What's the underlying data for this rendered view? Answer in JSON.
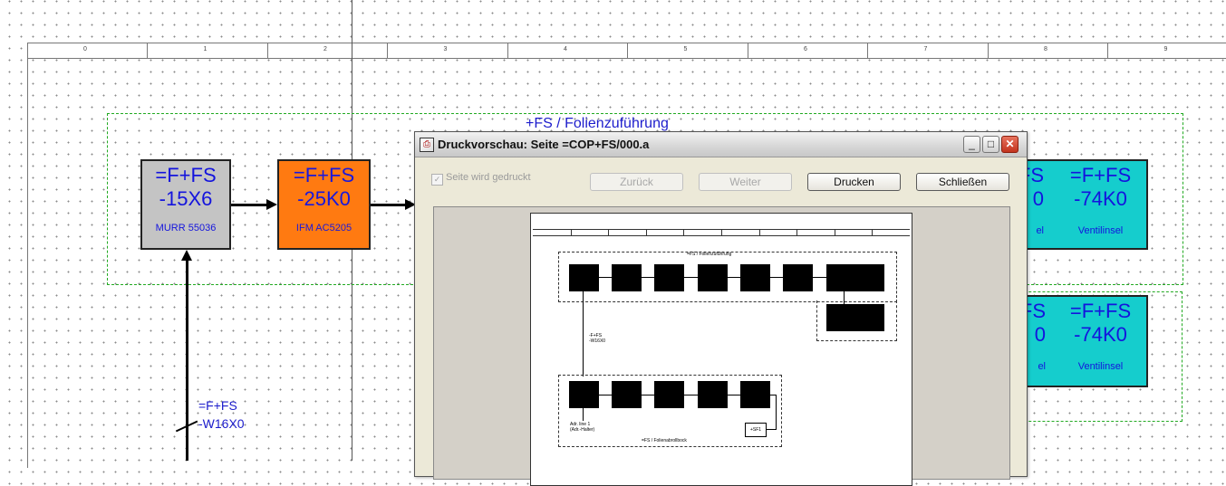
{
  "ruler": {
    "labels": [
      "0",
      "1",
      "2",
      "3",
      "4",
      "5",
      "6",
      "7",
      "8",
      "9"
    ]
  },
  "groups": {
    "top_title": "+FS / Folienzuführung"
  },
  "devices": [
    {
      "id": "d1",
      "line1": "=F+FS",
      "line2": "-15X6",
      "line3": "MURR 55036"
    },
    {
      "id": "d2",
      "line1": "=F+FS",
      "line2": "-25K0",
      "line3": "IFM AC5205"
    },
    {
      "id": "d3",
      "line1": "FS",
      "line2": "0",
      "line3": "el"
    },
    {
      "id": "d4",
      "line1": "=F+FS",
      "line2": "-74K0",
      "line3": "Ventilinsel"
    },
    {
      "id": "d5",
      "line1": "FS",
      "line2": "0",
      "line3": "el"
    },
    {
      "id": "d6",
      "line1": "=F+FS",
      "line2": "-74K0",
      "line3": "Ventilinsel"
    }
  ],
  "cable": {
    "line1": "=F+FS",
    "line2": "-W16X0"
  },
  "colors": {
    "gray": "#c4c4c4",
    "orange": "#ff7a11",
    "cyan": "#15cdcd",
    "dash_green": "#22aa22",
    "text_blue": "#1c1ccc"
  },
  "dialog": {
    "title": "Druckvorschau: Seite =COP+FS/000.a",
    "checkbox_label": "Seite wird gedruckt",
    "checkbox_checked": true,
    "buttons": {
      "back": "Zurück",
      "next": "Weiter",
      "print": "Drucken",
      "close": "Schließen"
    },
    "window_controls": {
      "minimize": "_",
      "maximize": "□",
      "close": "✕"
    },
    "icons": {
      "title_icon": "app-icon"
    },
    "preview": {
      "top_group_title": "=FS / Folienzuführung",
      "cable_label_1": "-F+FS",
      "cable_label_2": "-W16X0",
      "bottom_left_label_1": "Adr. line 1",
      "bottom_left_label_2": "(Adr.-Halter)",
      "bottom_group_title": "=FS / Folienabrollbock",
      "small_box": "+SF1"
    }
  }
}
